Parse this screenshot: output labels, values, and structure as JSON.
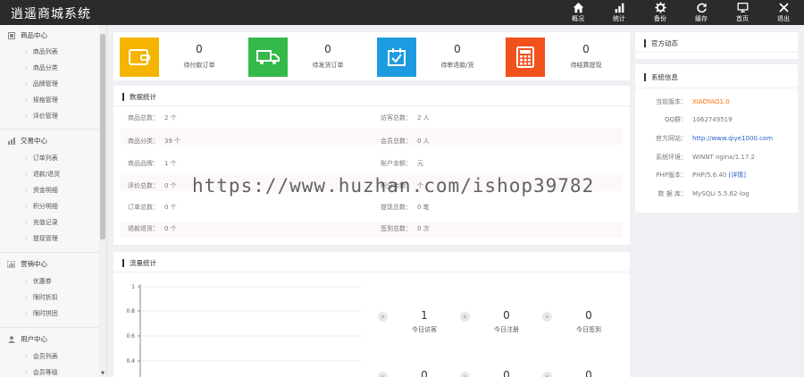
{
  "app": {
    "title": "逍遥商城系统"
  },
  "topnav": [
    {
      "label": "概况",
      "icon": "home-icon"
    },
    {
      "label": "统计",
      "icon": "bar-chart-icon"
    },
    {
      "label": "备份",
      "icon": "gear-icon"
    },
    {
      "label": "缓存",
      "icon": "refresh-icon"
    },
    {
      "label": "首页",
      "icon": "monitor-icon"
    },
    {
      "label": "退出",
      "icon": "close-icon"
    }
  ],
  "sidebar": {
    "groups": [
      {
        "title": "商品中心",
        "icon": "grid-icon",
        "items": [
          "商品列表",
          "商品分类",
          "品牌管理",
          "规格管理",
          "评价管理"
        ]
      },
      {
        "title": "交易中心",
        "icon": "bar-chart-icon",
        "items": [
          "订单列表",
          "退款/退货",
          "资金明细",
          "积分明细",
          "充值记录",
          "提现管理"
        ]
      },
      {
        "title": "营销中心",
        "icon": "chart-icon",
        "items": [
          "优惠券",
          "限时折扣",
          "限时拼团"
        ]
      },
      {
        "title": "用户中心",
        "icon": "user-icon",
        "items": [
          "会员列表",
          "会员等级"
        ]
      }
    ]
  },
  "stats": [
    {
      "value": "0",
      "label": "待付款订单",
      "color": "#f5b400",
      "icon": "wallet-icon"
    },
    {
      "value": "0",
      "label": "待发货订单",
      "color": "#35b94a",
      "icon": "truck-icon"
    },
    {
      "value": "0",
      "label": "待审退款/货",
      "color": "#1e9be0",
      "icon": "check-box-icon"
    },
    {
      "value": "0",
      "label": "待结算提现",
      "color": "#f1511b",
      "icon": "calculator-icon"
    }
  ],
  "data_stats": {
    "title": "数据统计",
    "left": [
      {
        "label": "商品总数：",
        "value": "2 个"
      },
      {
        "label": "商品分类：",
        "value": "39 个"
      },
      {
        "label": "商品品牌：",
        "value": "1 个"
      },
      {
        "label": "评价总数：",
        "value": "0 个"
      },
      {
        "label": "订单总数：",
        "value": "0 个"
      },
      {
        "label": "退款退货：",
        "value": "0 个"
      }
    ],
    "right": [
      {
        "label": "访客总数：",
        "value": "2 人"
      },
      {
        "label": "会员总数：",
        "value": "0 人"
      },
      {
        "label": "账户余额：",
        "value": "元"
      },
      {
        "label": "积分余额：",
        "value": "个"
      },
      {
        "label": "提现总数：",
        "value": "0 笔"
      },
      {
        "label": "签到总数：",
        "value": "0 次"
      }
    ]
  },
  "traffic": {
    "title": "流量统计",
    "y_ticks": [
      "1",
      "0.8",
      "0.6",
      "0.4"
    ],
    "metrics": [
      {
        "value": "1",
        "label": "今日访客"
      },
      {
        "value": "0",
        "label": "今日注册"
      },
      {
        "value": "0",
        "label": "今日签到"
      }
    ],
    "metrics_row2": [
      "0",
      "0",
      "0"
    ]
  },
  "chart_data": {
    "type": "line",
    "title": "流量统计",
    "xlabel": "",
    "ylabel": "",
    "ylim": [
      0.4,
      1
    ],
    "y_ticks": [
      1,
      0.8,
      0.6,
      0.4
    ],
    "series": []
  },
  "official": {
    "title": "官方动态"
  },
  "sysinfo": {
    "title": "系统信息",
    "rows": [
      {
        "label": "当前版本：",
        "value": "XIAOYAO1.0",
        "style": "orange"
      },
      {
        "label": "QQ群：",
        "value": "1062749519",
        "style": ""
      },
      {
        "label": "官方网站：",
        "value": "http://www.qiye1000.com",
        "style": "blue"
      },
      {
        "label": "系统环境：",
        "value": "WINNT nginx/1.17.2",
        "style": ""
      },
      {
        "label": "PHP版本：",
        "value": "PHP/5.6.40",
        "style": "",
        "extra": "[详情]"
      },
      {
        "label": "数 据 库：",
        "value": "MySQLi 5.5.62-log",
        "style": ""
      }
    ]
  },
  "watermark": "https://www.huzhan.com/ishop39782"
}
